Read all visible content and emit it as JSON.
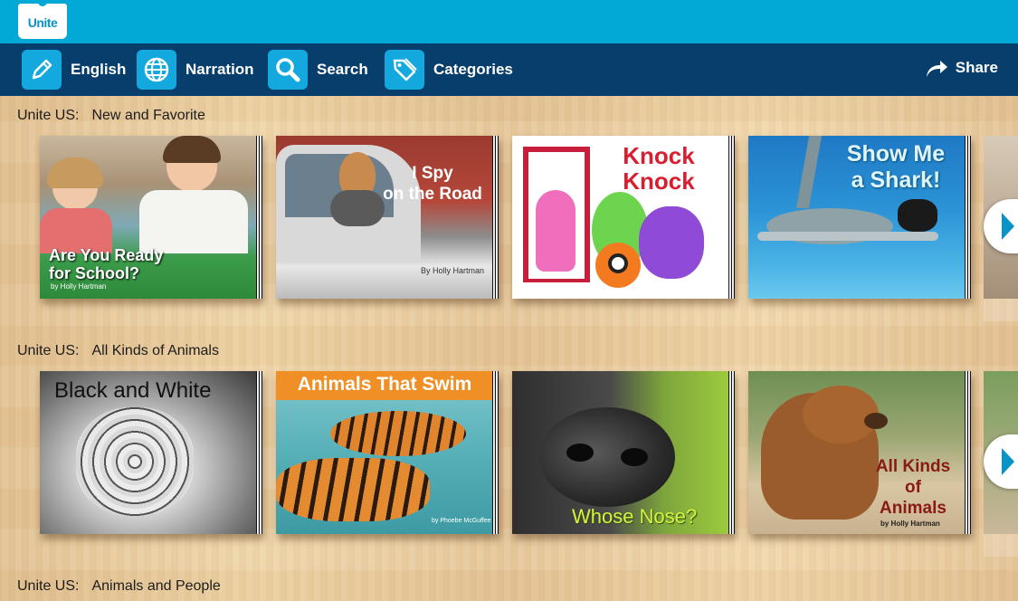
{
  "app": {
    "logo_text": "Unite"
  },
  "nav": {
    "items": [
      {
        "label": "English",
        "icon": "pencil-icon"
      },
      {
        "label": "Narration",
        "icon": "globe-icon"
      },
      {
        "label": "Search",
        "icon": "search-icon"
      },
      {
        "label": "Categories",
        "icon": "tag-icon"
      }
    ],
    "share_label": "Share"
  },
  "sections": [
    {
      "prefix": "Unite US:",
      "name": "New and Favorite",
      "books": [
        {
          "title_line1": "Are You Ready",
          "title_line2": "for School?",
          "author": "by Holly Hartman"
        },
        {
          "title_line1": "I Spy",
          "title_line2": "on the Road",
          "author": "By Holly Hartman"
        },
        {
          "title_line1": "Knock",
          "title_line2": "Knock",
          "author": ""
        },
        {
          "title_line1": "Show Me",
          "title_line2": "a Shark!",
          "author": ""
        }
      ]
    },
    {
      "prefix": "Unite US:",
      "name": "All Kinds of Animals",
      "books": [
        {
          "title_line1": "Black and White",
          "title_line2": "",
          "author": ""
        },
        {
          "title_line1": "Animals That Swim",
          "title_line2": "",
          "author": "by Phoebe McGuffee"
        },
        {
          "title_line1": "Whose Nose?",
          "title_line2": "",
          "author": ""
        },
        {
          "title_line1": "All Kinds",
          "title_line2": "of",
          "title_line3": "Animals",
          "author": "by Holly Hartman"
        }
      ]
    },
    {
      "prefix": "Unite US:",
      "name": "Animals and People"
    }
  ],
  "colors": {
    "topbar": "#02a8d6",
    "navbar": "#073e6b",
    "nav_icon_bg": "#13a9de",
    "arrow": "#0a93c7"
  }
}
